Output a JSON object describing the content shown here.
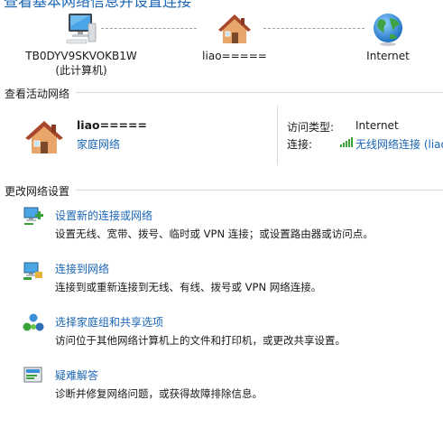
{
  "header": {
    "title": "查看基本网络信息并设置连接"
  },
  "map": {
    "computer": {
      "name": "TB0DYV9SKVOKB1W",
      "sub": "(此计算机)"
    },
    "network": {
      "name": "liao====="
    },
    "internet": {
      "name": "Internet"
    }
  },
  "active_networks": {
    "title": "查看活动网络",
    "network_name": "liao=====",
    "network_type": "家庭网络",
    "access_type_label": "访问类型:",
    "access_type_value": "Internet",
    "connection_label": "连接:",
    "connection_value": "无线网络连接 (liao"
  },
  "change_settings": {
    "title": "更改网络设置",
    "tasks": [
      {
        "link": "设置新的连接或网络",
        "desc": "设置无线、宽带、拨号、临时或 VPN 连接；或设置路由器或访问点。",
        "icon": "new-connection-icon"
      },
      {
        "link": "连接到网络",
        "desc": "连接到或重新连接到无线、有线、拨号或 VPN 网络连接。",
        "icon": "connect-network-icon"
      },
      {
        "link": "选择家庭组和共享选项",
        "desc": "访问位于其他网络计算机上的文件和打印机，或更改共享设置。",
        "icon": "homegroup-icon"
      },
      {
        "link": "疑难解答",
        "desc": "诊断并修复网络问题，或获得故障排除信息。",
        "icon": "troubleshoot-icon"
      }
    ]
  },
  "colors": {
    "link": "#1a66b5",
    "rule": "#d6dbe2"
  }
}
